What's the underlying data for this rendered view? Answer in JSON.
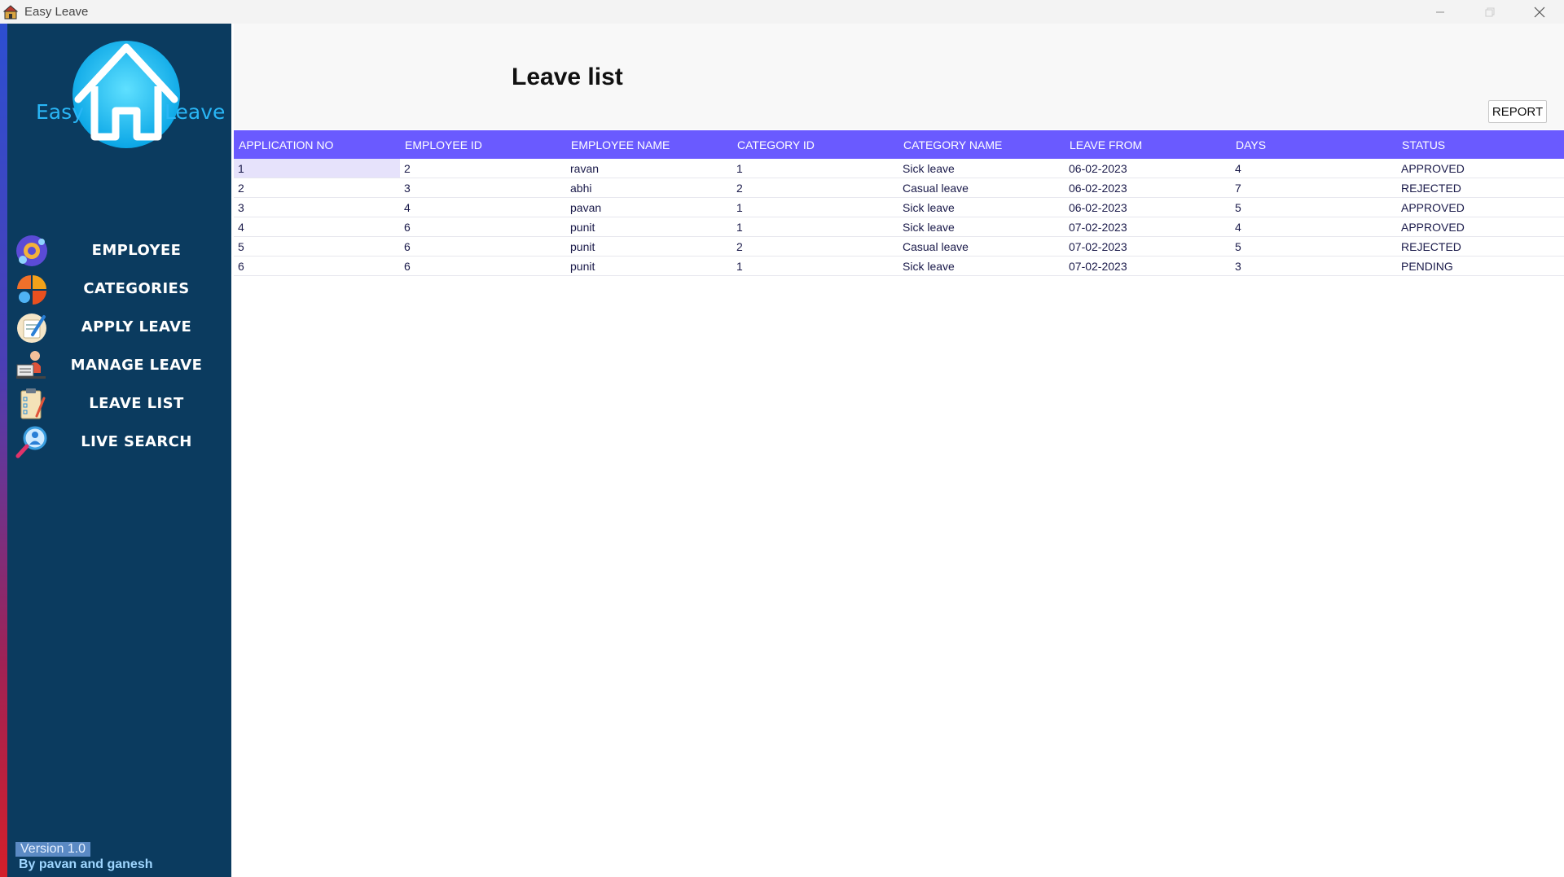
{
  "window": {
    "title": "Easy Leave"
  },
  "sidebar": {
    "logo_left": "Easy",
    "logo_right": "Leave",
    "items": [
      {
        "label": "EMPLOYEE",
        "icon": "employee-gear-icon"
      },
      {
        "label": "CATEGORIES",
        "icon": "categories-icon"
      },
      {
        "label": "APPLY LEAVE",
        "icon": "apply-leave-icon"
      },
      {
        "label": "MANAGE LEAVE",
        "icon": "manage-leave-icon"
      },
      {
        "label": "LEAVE LIST",
        "icon": "clipboard-icon"
      },
      {
        "label": "LIVE SEARCH",
        "icon": "search-person-icon"
      }
    ],
    "version": "Version 1.0",
    "byline": "By pavan and ganesh"
  },
  "main": {
    "title": "Leave list",
    "report_label": "REPORT",
    "columns": [
      "APPLICATION NO",
      "EMPLOYEE  ID",
      "EMPLOYEE NAME",
      "CATEGORY ID",
      "CATEGORY NAME",
      "LEAVE FROM",
      "DAYS",
      "STATUS"
    ],
    "rows": [
      [
        "1",
        "2",
        "ravan",
        "1",
        "Sick leave",
        "06-02-2023",
        "4",
        "APPROVED"
      ],
      [
        "2",
        "3",
        "abhi",
        "2",
        "Casual leave",
        "06-02-2023",
        "7",
        "REJECTED"
      ],
      [
        "3",
        "4",
        "pavan",
        "1",
        "Sick leave",
        "06-02-2023",
        "5",
        "APPROVED"
      ],
      [
        "4",
        "6",
        "punit",
        "1",
        "Sick leave",
        "07-02-2023",
        "4",
        "APPROVED"
      ],
      [
        "5",
        "6",
        "punit",
        "2",
        "Casual leave",
        "07-02-2023",
        "5",
        "REJECTED"
      ],
      [
        "6",
        "6",
        "punit",
        "1",
        "Sick leave",
        "07-02-2023",
        "3",
        "PENDING"
      ]
    ]
  },
  "colors": {
    "sidebar_bg": "#0b3b5f",
    "table_header": "#6a5aff",
    "logo_accent": "#29b6f6"
  }
}
